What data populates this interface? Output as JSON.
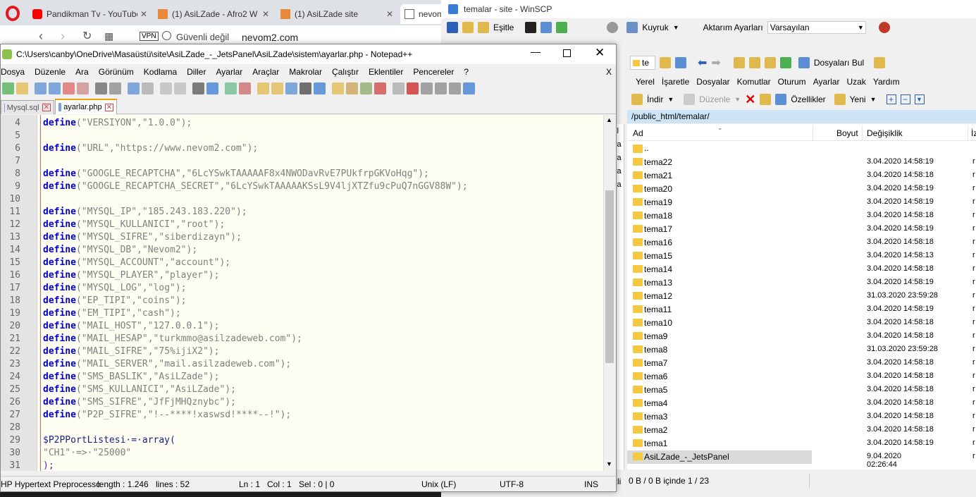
{
  "browser": {
    "tabs": [
      {
        "label": "Pandikman Tv - YouTube",
        "icon": "youtube-icon",
        "close": "✕"
      },
      {
        "label": "(1) AsiLZade - Afro2 W",
        "icon": "site-icon",
        "close": "✕"
      },
      {
        "label": "(1) AsiLZade site",
        "icon": "site-icon",
        "close": "✕"
      },
      {
        "label": "nevom",
        "icon": "page-icon",
        "close": ""
      }
    ],
    "vpn": "VPN",
    "security": "Güvenli değil",
    "url": "nevom2.com"
  },
  "winscp": {
    "title": "temalar - site - WinSCP",
    "toolbar1": {
      "sync": "Eşitle",
      "queue": "Kuyruk",
      "transfer_settings": "Aktarım Ayarları",
      "transfer_value": "Varsayılan"
    },
    "toolbar2": {
      "drive": "te",
      "find": "Dosyaları Bul"
    },
    "menu": [
      "Yerel",
      "İşaretle",
      "Dosyalar",
      "Komutlar",
      "Oturum",
      "Ayarlar",
      "Uzak",
      "Yardım"
    ],
    "toolbar3": {
      "download": "İndir",
      "edit": "Düzenle",
      "properties": "Özellikler",
      "new": "Yeni"
    },
    "path": "/public_html/temalar/",
    "columns": {
      "name": "Ad",
      "size": "Boyut",
      "changed": "Değişiklik",
      "rights": "İz"
    },
    "parent": "..",
    "files": [
      {
        "name": "tema22",
        "date": "3.04.2020 14:58:19",
        "r": "r"
      },
      {
        "name": "tema21",
        "date": "3.04.2020 14:58:18",
        "r": "r"
      },
      {
        "name": "tema20",
        "date": "3.04.2020 14:58:19",
        "r": "r"
      },
      {
        "name": "tema19",
        "date": "3.04.2020 14:58:19",
        "r": "r"
      },
      {
        "name": "tema18",
        "date": "3.04.2020 14:58:18",
        "r": "r"
      },
      {
        "name": "tema17",
        "date": "3.04.2020 14:58:19",
        "r": "r"
      },
      {
        "name": "tema16",
        "date": "3.04.2020 14:58:18",
        "r": "r"
      },
      {
        "name": "tema15",
        "date": "3.04.2020 14:58:13",
        "r": "r"
      },
      {
        "name": "tema14",
        "date": "3.04.2020 14:58:18",
        "r": "r"
      },
      {
        "name": "tema13",
        "date": "3.04.2020 14:58:19",
        "r": "r"
      },
      {
        "name": "tema12",
        "date": "31.03.2020 23:59:28",
        "r": "r"
      },
      {
        "name": "tema11",
        "date": "3.04.2020 14:58:19",
        "r": "r"
      },
      {
        "name": "tema10",
        "date": "3.04.2020 14:58:18",
        "r": "r"
      },
      {
        "name": "tema9",
        "date": "3.04.2020 14:58:18",
        "r": "r"
      },
      {
        "name": "tema8",
        "date": "31.03.2020 23:59:28",
        "r": "r"
      },
      {
        "name": "tema7",
        "date": "3.04.2020 14:58:18",
        "r": "r"
      },
      {
        "name": "tema6",
        "date": "3.04.2020 14:58:18",
        "r": "r"
      },
      {
        "name": "tema5",
        "date": "3.04.2020 14:58:18",
        "r": "r"
      },
      {
        "name": "tema4",
        "date": "3.04.2020 14:58:18",
        "r": "r"
      },
      {
        "name": "tema3",
        "date": "3.04.2020 14:58:18",
        "r": "r"
      },
      {
        "name": "tema2",
        "date": "3.04.2020 14:58:18",
        "r": "r"
      },
      {
        "name": "tema1",
        "date": "3.04.2020 14:58:19",
        "r": "r"
      },
      {
        "name": "AsiLZade_-_JetsPanel",
        "date": "9.04.2020 02:26:44",
        "r": "r"
      }
    ],
    "status": "0 B / 0 B içinde 1 / 23",
    "status_left": "zli"
  },
  "npp": {
    "title": "C:\\Users\\canby\\OneDrive\\Masaüstü\\site\\AsiLZade_-_JetsPanel\\AsiLZade\\sistem\\ayarlar.php - Notepad++",
    "menu": [
      "Dosya",
      "Düzenle",
      "Ara",
      "Görünüm",
      "Kodlama",
      "Diller",
      "Ayarlar",
      "Araçlar",
      "Makrolar",
      "Çalıştır",
      "Eklentiler",
      "Pencereler",
      "?"
    ],
    "menu_close": "X",
    "tabs": [
      "Mysql.sql",
      "ayarlar.php"
    ],
    "lines": [
      {
        "n": "4",
        "kw": "define",
        "rest": "(\"VERSIYON\",\"1.0.0\");"
      },
      {
        "n": "5",
        "kw": "",
        "rest": ""
      },
      {
        "n": "6",
        "kw": "define",
        "rest": "(\"URL\",\"https://www.nevom2.com\");"
      },
      {
        "n": "7",
        "kw": "",
        "rest": ""
      },
      {
        "n": "8",
        "kw": "define",
        "rest": "(\"GOOGLE_RECAPTCHA\",\"6LcYSwkTAAAAAF8x4NWODavRvE7PUkfrpGKVoHqg\");"
      },
      {
        "n": "9",
        "kw": "define",
        "rest": "(\"GOOGLE_RECAPTCHA_SECRET\",\"6LcYSwkTAAAAAKSsL9V4ljXTZfu9cPuQ7nGGV88W\");"
      },
      {
        "n": "10",
        "kw": "",
        "rest": ""
      },
      {
        "n": "11",
        "kw": "define",
        "rest": "(\"MYSQL_IP\",\"185.243.183.220\");"
      },
      {
        "n": "12",
        "kw": "define",
        "rest": "(\"MYSQL_KULLANICI\",\"root\");"
      },
      {
        "n": "13",
        "kw": "define",
        "rest": "(\"MYSQL_SIFRE\",\"siberdizayn\");"
      },
      {
        "n": "14",
        "kw": "define",
        "rest": "(\"MYSQL_DB\",\"Nevom2\");"
      },
      {
        "n": "15",
        "kw": "define",
        "rest": "(\"MYSQL_ACCOUNT\",\"account\");"
      },
      {
        "n": "16",
        "kw": "define",
        "rest": "(\"MYSQL_PLAYER\",\"player\");"
      },
      {
        "n": "17",
        "kw": "define",
        "rest": "(\"MYSQL_LOG\",\"log\");"
      },
      {
        "n": "18",
        "kw": "define",
        "rest": "(\"EP_TIPI\",\"coins\");"
      },
      {
        "n": "19",
        "kw": "define",
        "rest": "(\"EM_TIPI\",\"cash\");"
      },
      {
        "n": "20",
        "kw": "define",
        "rest": "(\"MAIL_HOST\",\"127.0.0.1\");"
      },
      {
        "n": "21",
        "kw": "define",
        "rest": "(\"MAIL_HESAP\",\"turkmmo@asilzadeweb.com\");"
      },
      {
        "n": "22",
        "kw": "define",
        "rest": "(\"MAIL_SIFRE\",\"75%ijiX2\");"
      },
      {
        "n": "23",
        "kw": "define",
        "rest": "(\"MAIL_SERVER\",\"mail.asilzadeweb.com\");"
      },
      {
        "n": "24",
        "kw": "define",
        "rest": "(\"SMS_BASLIK\",\"AsiLZade\");"
      },
      {
        "n": "25",
        "kw": "define",
        "rest": "(\"SMS_KULLANICI\",\"AsiLZade\");"
      },
      {
        "n": "26",
        "kw": "define",
        "rest": "(\"SMS_SIFRE\",\"JfFjMHQznybc\");"
      },
      {
        "n": "27",
        "kw": "define",
        "rest": "(\"P2P_SIFRE\",\"!--****!xaswsd!****--!\");"
      },
      {
        "n": "28",
        "kw": "",
        "rest": ""
      },
      {
        "n": "29",
        "kw": "",
        "rest": "$P2PPortListesi·=·array("
      },
      {
        "n": "30",
        "kw": "",
        "rest": "\"CH1\"·=>·\"25000\""
      },
      {
        "n": "31",
        "kw": "",
        "rest": ");"
      }
    ],
    "status": {
      "lang": "HP Hypertext Preprocesso",
      "length": "length : 1.246",
      "lines": "lines : 52",
      "ln": "Ln : 1",
      "col": "Col : 1",
      "sel": "Sel : 0 | 0",
      "eol": "Unix (LF)",
      "enc": "UTF-8",
      "ins": "INS"
    }
  }
}
